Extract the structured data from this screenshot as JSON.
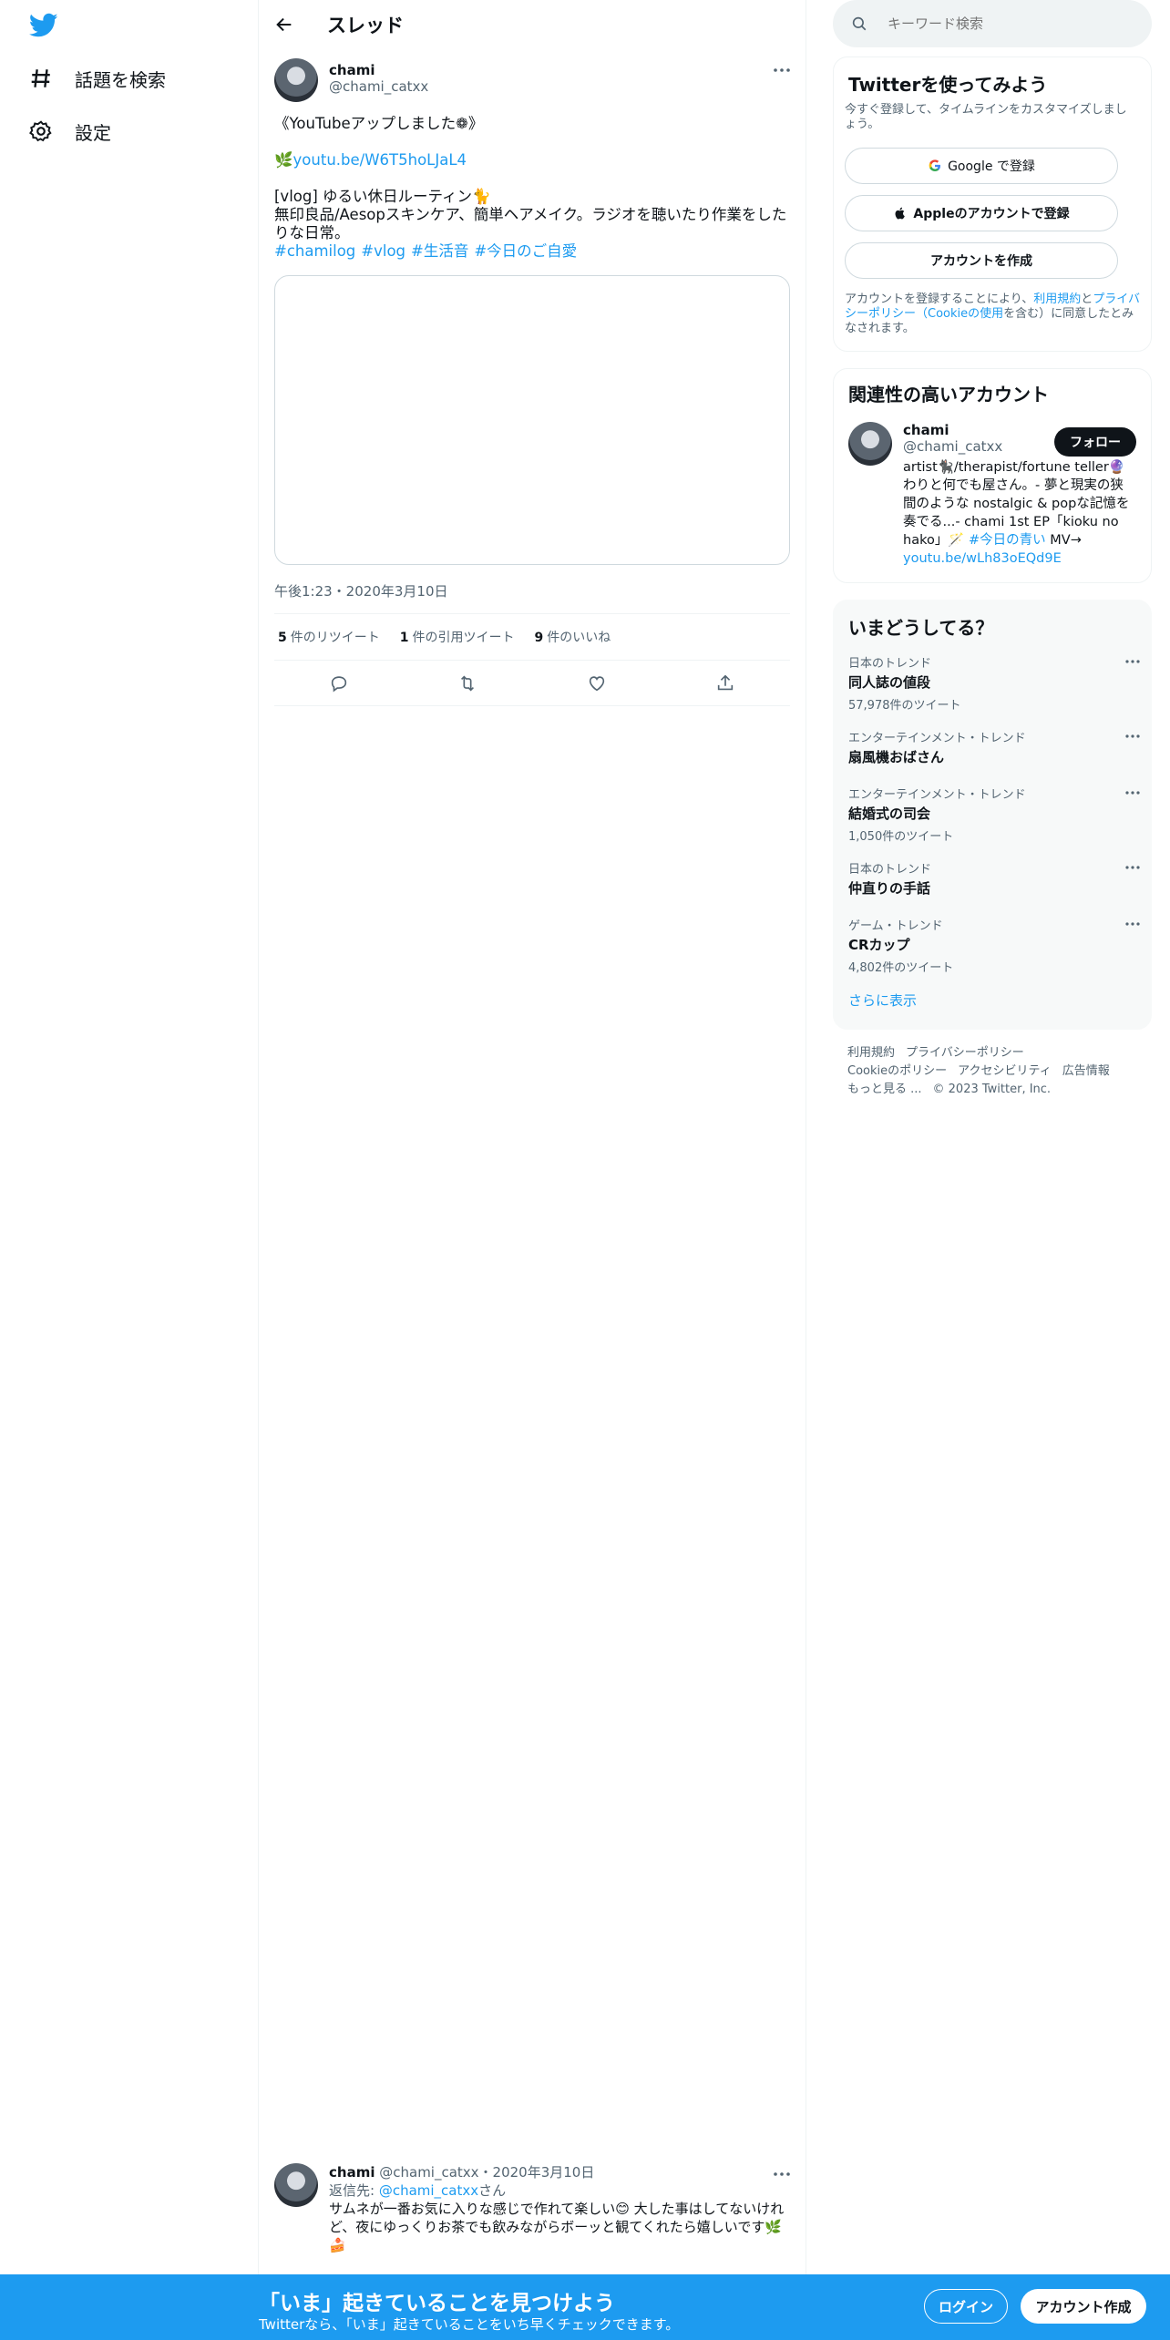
{
  "nav": {
    "explore_label": "話題を検索",
    "settings_label": "設定"
  },
  "thread": {
    "header_title": "スレッド",
    "author_name": "chami",
    "author_handle": "@chami_catxx",
    "line1": "《YouTubeアップしました❁》",
    "link_prefix": "🌿",
    "link": "youtu.be/W6T5hoLJaL4",
    "line3": "[vlog] ゆるい休日ルーティン🐈",
    "line4": "無印良品/Aesopスキンケア、簡単ヘアメイク。ラジオを聴いたり作業をしたりな日常。",
    "hashtags": [
      "#chamilog",
      "#vlog",
      "#生活音",
      "#今日のご自愛"
    ],
    "timestamp": "午後1:23・2020年3月10日",
    "retweets_count": "5",
    "retweets_label": "件のリツイート",
    "quotes_count": "1",
    "quotes_label": "件の引用ツイート",
    "likes_count": "9",
    "likes_label": "件のいいね"
  },
  "reply": {
    "name": "chami",
    "handle_date": "@chami_catxx・2020年3月10日",
    "reply_to_label": "返信先: ",
    "reply_to_handle": "@chami_catxx",
    "reply_to_suffix": "さん",
    "text": "サムネが一番お気に入りな感じで作れて楽しい😊 大した事はしてないけれど、夜にゆっくりお茶でも飲みながらボーッと観てくれたら嬉しいです🌿🍰"
  },
  "search": {
    "placeholder": "キーワード検索"
  },
  "signup": {
    "title": "Twitterを使ってみよう",
    "subtitle": "今すぐ登録して、タイムラインをカスタマイズしましょう。",
    "google_label": "Google で登録",
    "apple_label": "Appleのアカウントで登録",
    "create_label": "アカウントを作成",
    "terms_prefix": "アカウントを登録することにより、",
    "terms_link1": "利用規約",
    "terms_and": "と",
    "terms_link2": "プライバシーポリシー（Cookieの使用",
    "terms_suffix": "を含む）に同意したとみなされます。"
  },
  "related": {
    "title": "関連性の高いアカウント",
    "name": "chami",
    "handle": "@chami_catxx",
    "follow_label": "フォロー",
    "bio": "artist🐈‍⬛/therapist/fortune teller🔮 わりと何でも屋さん。- 夢と現実の狭間のような nostalgic & popな記憶を奏でる...- chami 1st EP「kioku no hako」🪄",
    "bio_hashtag": "#今日の青い",
    "bio_tail": " MV→",
    "bio_link": "youtu.be/wLh83oEQd9E"
  },
  "trends": {
    "title": "いまどうしてる？",
    "items": [
      {
        "category": "日本のトレンド",
        "name": "同人誌の値段",
        "count": "57,978件のツイート"
      },
      {
        "category": "エンターテインメント・トレンド",
        "name": "扇風機おばさん",
        "count": ""
      },
      {
        "category": "エンターテインメント・トレンド",
        "name": "結婚式の司会",
        "count": "1,050件のツイート"
      },
      {
        "category": "日本のトレンド",
        "name": "仲直りの手話",
        "count": ""
      },
      {
        "category": "ゲーム・トレンド",
        "name": "CRカップ",
        "count": "4,802件のツイート"
      }
    ],
    "show_more": "さらに表示"
  },
  "footer": {
    "links": [
      "利用規約",
      "プライバシーポリシー",
      "Cookieのポリシー",
      "アクセシビリティ",
      "広告情報",
      "もっと見る ..."
    ],
    "copyright": "© 2023 Twitter, Inc."
  },
  "bottom_bar": {
    "title": "「いま」起きていることを見つけよう",
    "subtitle": "Twitterなら、「いま」起きていることをいち早くチェックできます。",
    "login_label": "ログイン",
    "signup_label": "アカウント作成"
  }
}
